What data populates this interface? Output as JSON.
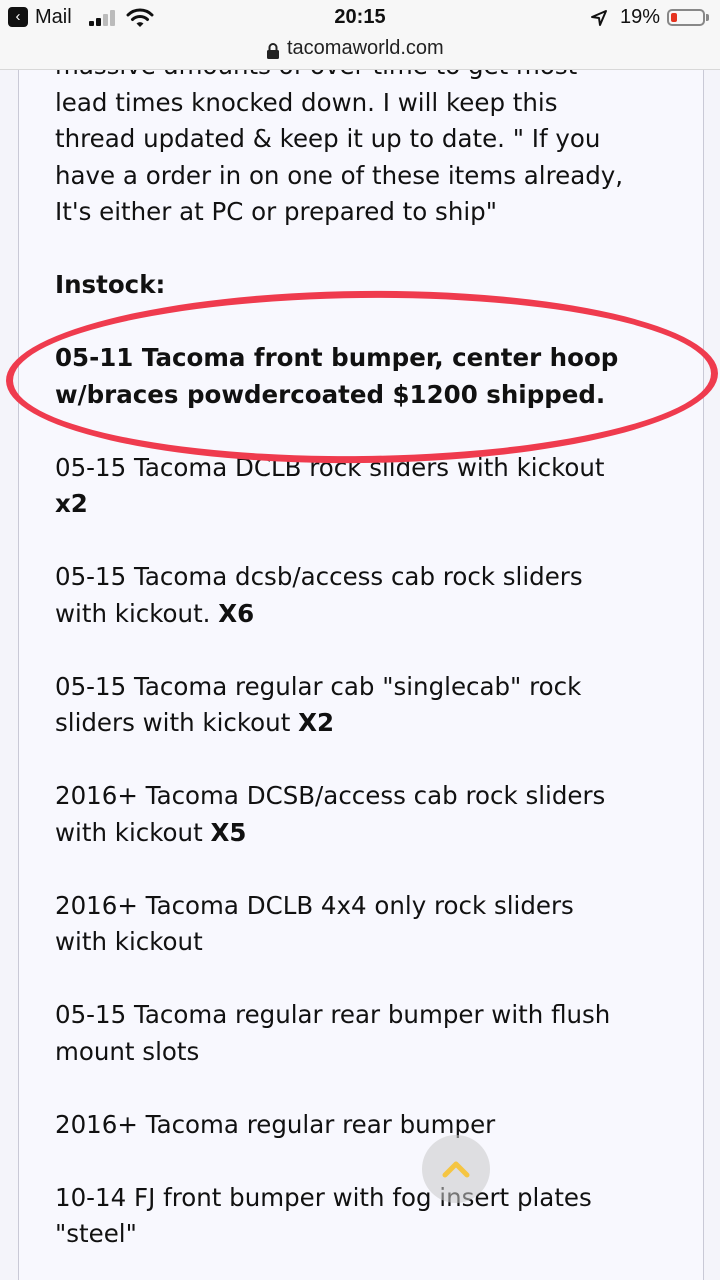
{
  "status_bar": {
    "back_app": "Mail",
    "time": "20:15",
    "battery_percent": "19%",
    "battery_level": 0.19,
    "battery_color": "#e5331f"
  },
  "address_bar": {
    "url": "tacomaworld.com",
    "lock_icon": "lock-icon"
  },
  "post": {
    "intro_lines": [
      "massive amounts of over time to get most",
      "lead times knocked down. I will keep this",
      "thread updated & keep it up to date. \" If you",
      "have a order in on one of these items already,",
      "It's either at PC or prepared to ship\""
    ],
    "section_heading": "Instock:",
    "highlighted_item": {
      "line1": "05-11 Tacoma front bumper, center hoop",
      "line2": "w/braces powdercoated $1200 shipped."
    },
    "items": [
      {
        "text": "05-15 Tacoma DCLB rock sliders with kickout",
        "qty": "x2"
      },
      {
        "text": "05-15 Tacoma dcsb/access cab rock sliders",
        "text2": "with kickout. ",
        "qty": "X6"
      },
      {
        "text": "05-15 Tacoma regular cab \"singlecab\" rock",
        "text2": "sliders with kickout ",
        "qty": "X2"
      },
      {
        "text": "2016+ Tacoma DCSB/access cab rock sliders",
        "text2": "with kickout ",
        "qty": "X5"
      },
      {
        "text": "2016+ Tacoma DCLB 4x4 only rock sliders",
        "text2": "with kickout"
      },
      {
        "text": "05-15 Tacoma regular rear bumper with flush",
        "text2": "mount slots"
      },
      {
        "text": "2016+ Tacoma regular rear bumper"
      },
      {
        "text": "10-14 FJ front bumper with fog insert plates",
        "text2": "\"steel\""
      }
    ]
  },
  "colors": {
    "highlight_ring": "#ef3b4e",
    "content_background": "#f8f8fe"
  }
}
